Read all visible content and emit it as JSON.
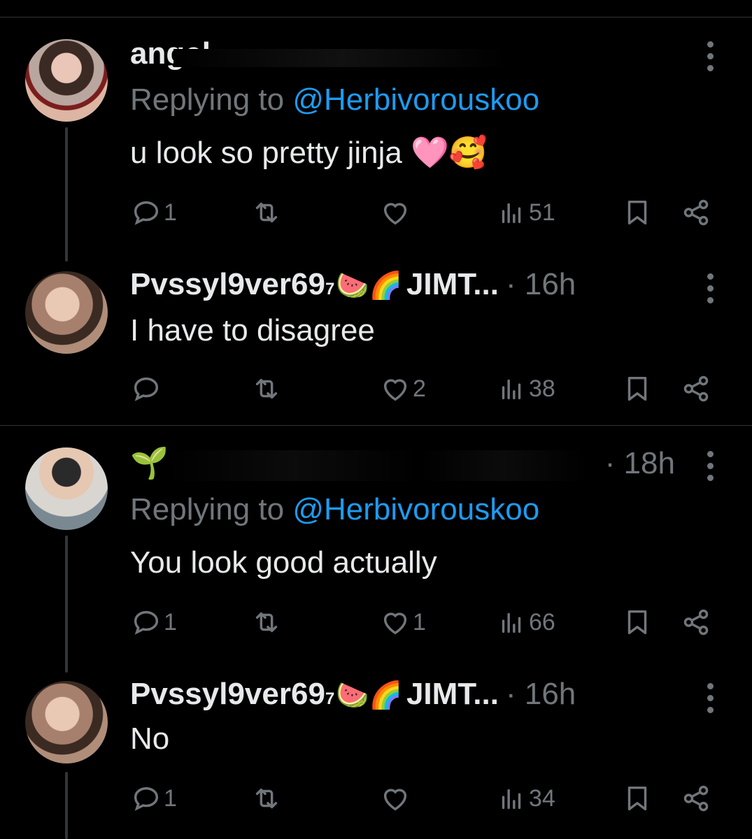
{
  "colors": {
    "background": "#000000",
    "text": "#e7e9ea",
    "muted": "#71767b",
    "link": "#1d9bf0",
    "divider": "#2f3336"
  },
  "threads": [
    {
      "parent": {
        "name": "angel",
        "replying_prefix": "Replying to ",
        "replying_handle": "@Herbivorouskoo",
        "text": "u look so pretty jinja 🩷🥰",
        "replies": "1",
        "reposts": "",
        "likes": "",
        "views": "51"
      },
      "reply": {
        "name": "Pvssyl9ver69",
        "superscript": "7",
        "emojis": "🍉🌈",
        "name_suffix": "JIMT...",
        "time": "· 16h",
        "text": "I have to disagree",
        "replies": "",
        "reposts": "",
        "likes": "2",
        "views": "38"
      }
    },
    {
      "parent": {
        "name": "🌱+",
        "time": "· 18h",
        "replying_prefix": "Replying to ",
        "replying_handle": "@Herbivorouskoo",
        "text": "You look good actually",
        "replies": "1",
        "reposts": "",
        "likes": "1",
        "views": "66"
      },
      "reply": {
        "name": "Pvssyl9ver69",
        "superscript": "7",
        "emojis": "🍉🌈",
        "name_suffix": "JIMT...",
        "time": "· 16h",
        "text": "No",
        "replies": "1",
        "reposts": "",
        "likes": "",
        "views": "34"
      }
    }
  ],
  "icons": [
    "reply-icon",
    "repost-icon",
    "like-icon",
    "views-icon",
    "bookmark-icon",
    "share-icon",
    "more-icon"
  ]
}
